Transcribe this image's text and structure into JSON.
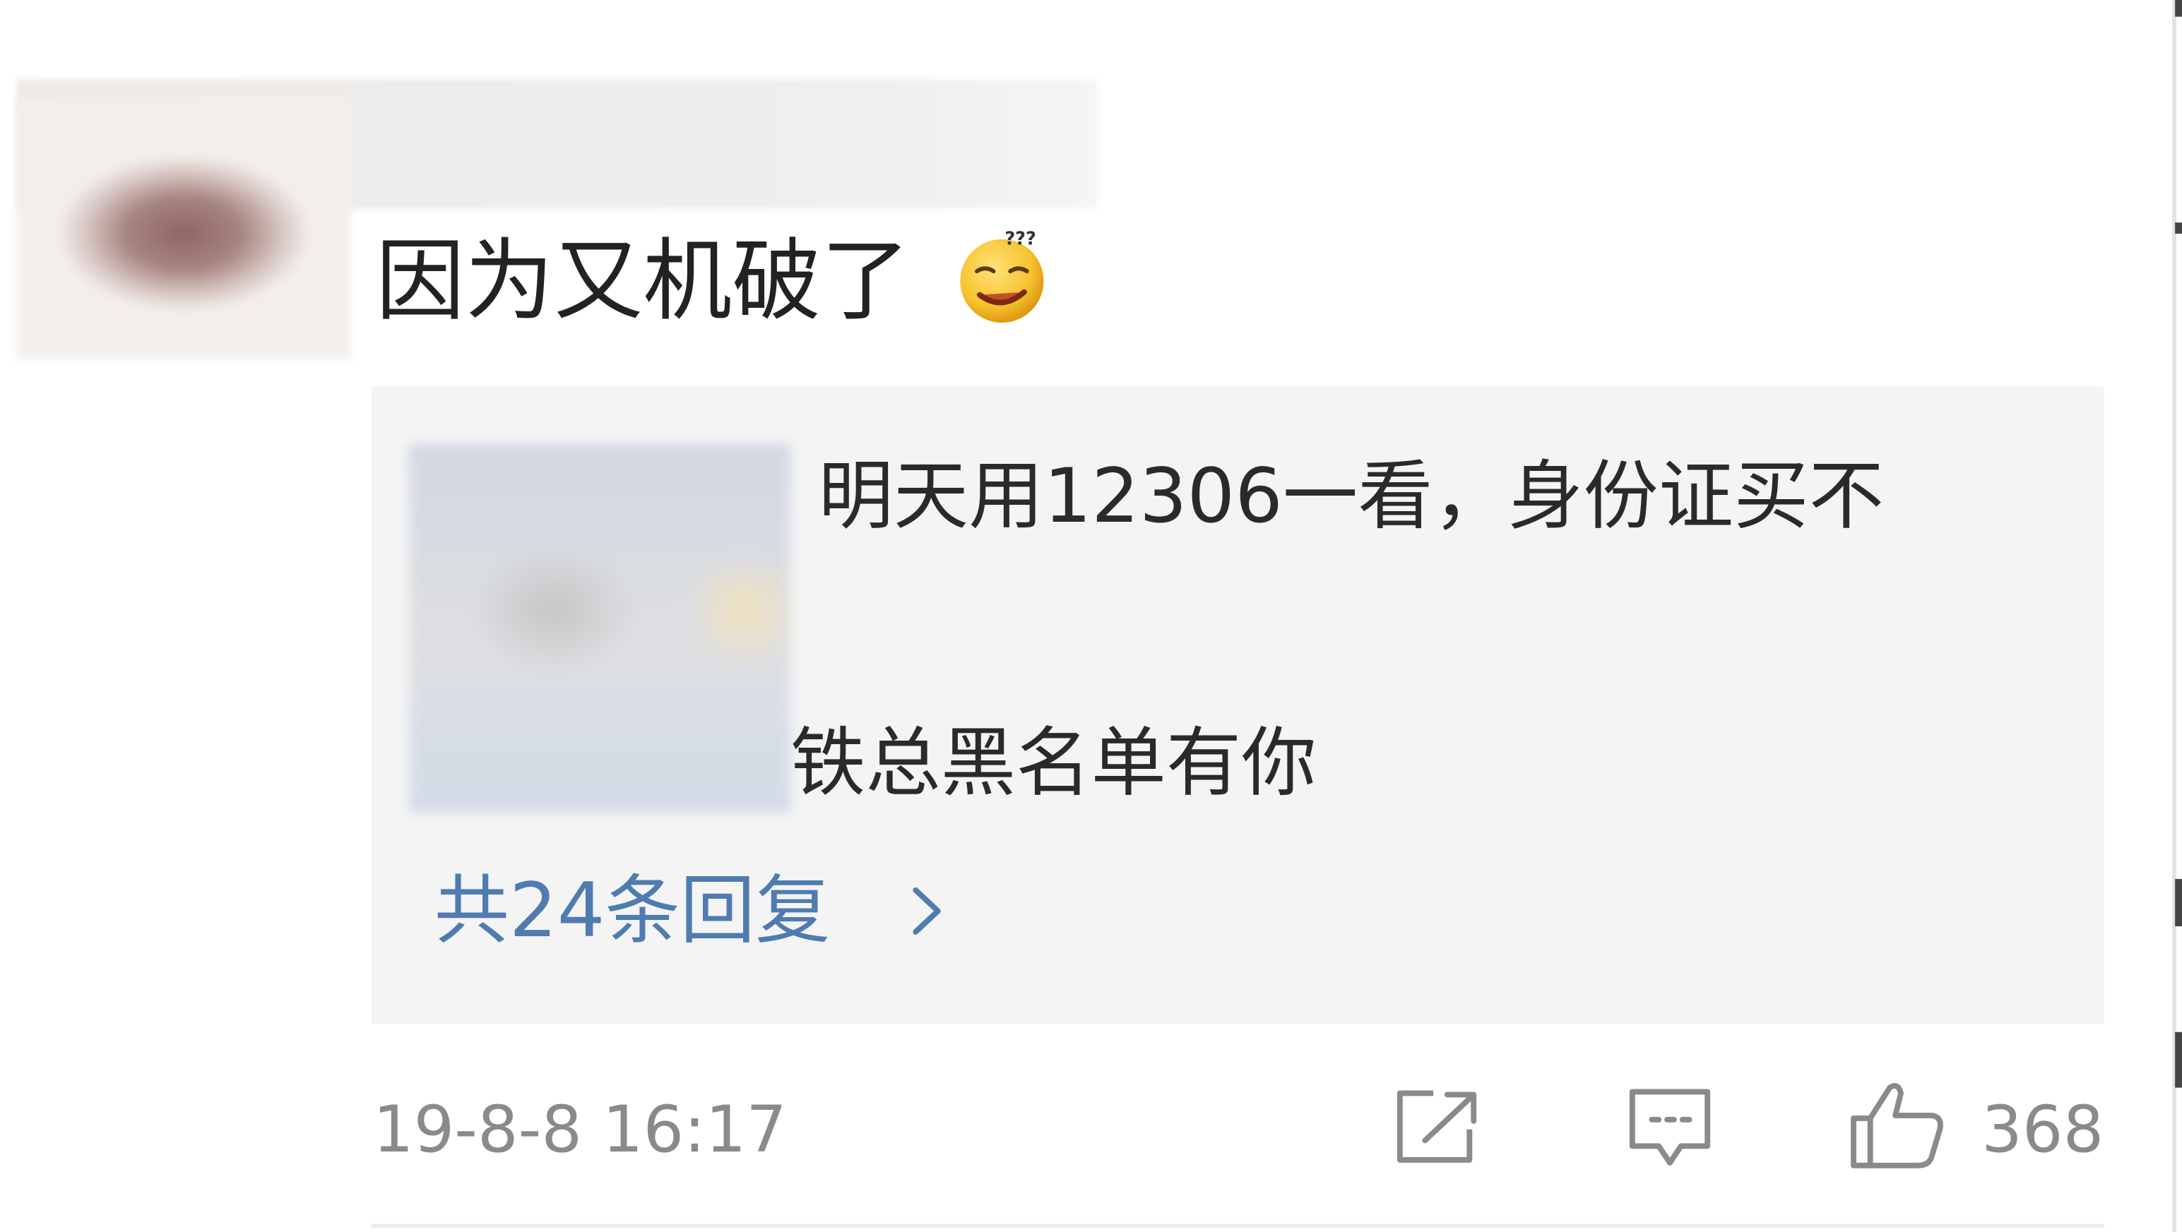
{
  "comment": {
    "text": "因为又机破了",
    "emoji": "dizzy-confused-emoji",
    "quoted_reply": {
      "line1": "明天用12306一看，身份证买不",
      "line2": "铁总黑名单有你"
    },
    "replies_link": "共24条回复",
    "timestamp": "19-8-8 16:17",
    "like_count": "368"
  },
  "icons": {
    "replies_chevron": "chevron-right-icon",
    "share": "share-icon",
    "comment": "comment-icon",
    "like": "thumbs-up-icon"
  },
  "colors": {
    "link": "#4f7cb0",
    "meta_text": "#8a8a8a",
    "quote_background": "#f4f4f4"
  }
}
